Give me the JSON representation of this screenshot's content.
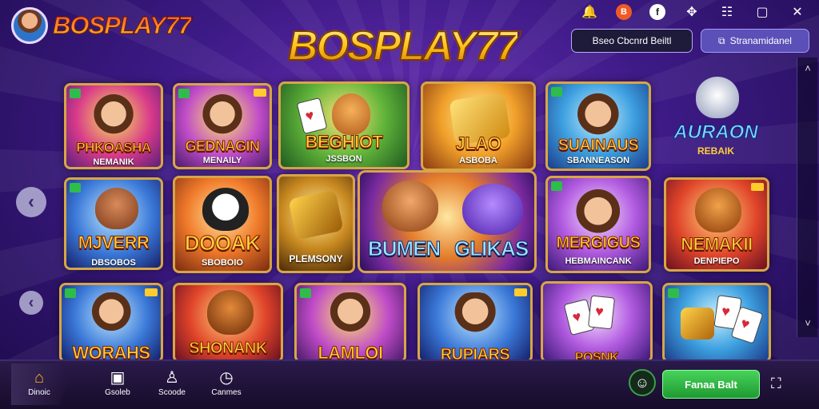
{
  "brand": {
    "name": "BOSPLAY77"
  },
  "title": "BOSPLAY77",
  "header_buttons": {
    "left": "Bseo Cbcnrd Beiltl",
    "right": "Stranamidanel"
  },
  "top_icons": [
    "notification-icon",
    "brand-logo-icon",
    "facebook-icon",
    "puzzle-icon",
    "menu-icon",
    "maximize-icon",
    "close-icon"
  ],
  "tiles": [
    {
      "name": "PHKOASHA",
      "sub": "NEMANIK"
    },
    {
      "name": "GEDNAGIN",
      "sub": "MENAILY"
    },
    {
      "name": "BEGHIOT",
      "sub": "JSSBON"
    },
    {
      "name": "JLAO",
      "sub": "ASBOBA"
    },
    {
      "name": "SUAINAUS",
      "sub": "SBANNEASON"
    },
    {
      "name": "MJVERR",
      "sub": "DBSOBOS"
    },
    {
      "name": "DOOAK",
      "sub": "SBOBOIO"
    },
    {
      "name": "PLEMSONY",
      "sub": ""
    },
    {
      "name": "MERGIGUS",
      "sub": "HEBMAINCANK"
    },
    {
      "name": "NEMAKII",
      "sub": "DENPIEPO"
    },
    {
      "name": "WORAHS",
      "sub": ""
    },
    {
      "name": "SHONANK",
      "sub": ""
    },
    {
      "name": "LAMLOI",
      "sub": ""
    },
    {
      "name": "RUPIARS",
      "sub": ""
    },
    {
      "name": "POSNK",
      "sub": ""
    },
    {
      "name": "",
      "sub": ""
    }
  ],
  "feature": {
    "name1": "BUMEN",
    "name2": "GLIKAS"
  },
  "aura": {
    "name": "AURAON",
    "sub": "REBAIK"
  },
  "nav": [
    {
      "label": "Dinoic",
      "icon": "⌂"
    },
    {
      "label": "Gsoleb",
      "icon": "▣"
    },
    {
      "label": "Scoode",
      "icon": "♙"
    },
    {
      "label": "Canmes",
      "icon": "◷"
    }
  ],
  "primary_button": "Fanaa Balt",
  "arrows": {
    "left": "‹",
    "up": "˄",
    "down": "˅"
  }
}
